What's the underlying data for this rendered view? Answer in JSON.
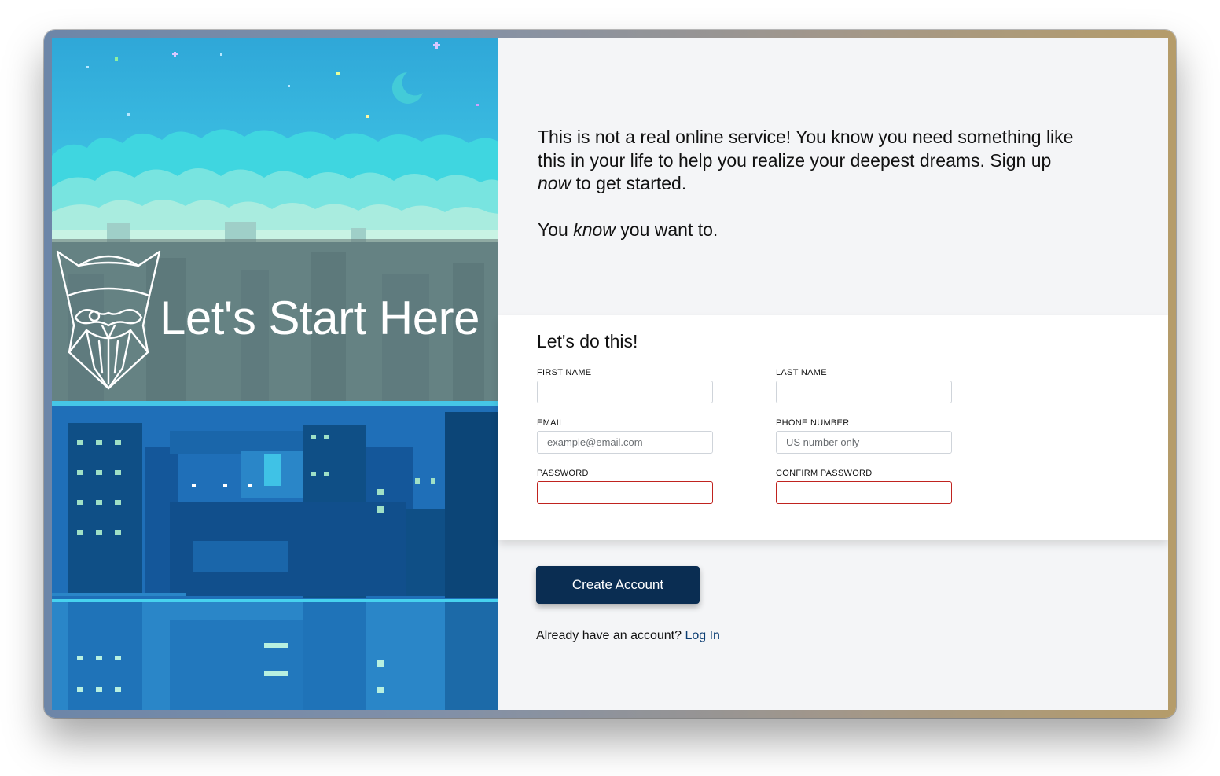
{
  "hero": {
    "title": "Let's Start Here",
    "logo_icon": "viking-helmet-beard-icon"
  },
  "intro": {
    "line1": "This is not a real online service! You know you need something like this in your life to help you realize your deepest dreams. Sign up ",
    "line1_em": "now",
    "line1_end": " to get started.",
    "line2_start": "You ",
    "line2_em": "know",
    "line2_end": " you want to."
  },
  "form": {
    "heading": "Let's do this!",
    "first_name": {
      "label": "FIRST NAME",
      "value": "",
      "placeholder": ""
    },
    "last_name": {
      "label": "LAST NAME",
      "value": "",
      "placeholder": ""
    },
    "email": {
      "label": "EMAIL",
      "value": "",
      "placeholder": "example@email.com"
    },
    "phone": {
      "label": "PHONE NUMBER",
      "value": "",
      "placeholder": "US number only"
    },
    "password": {
      "label": "PASSWORD",
      "value": "",
      "placeholder": ""
    },
    "confirm_password": {
      "label": "CONFIRM PASSWORD",
      "value": "",
      "placeholder": ""
    }
  },
  "actions": {
    "create_label": "Create Account",
    "login_prompt": "Already have an account?",
    "login_link": "Log In"
  },
  "colors": {
    "button": "#0a2d52",
    "link": "#0b3d73",
    "invalid_border": "#c0231f",
    "page_background": "#f4f5f7"
  }
}
